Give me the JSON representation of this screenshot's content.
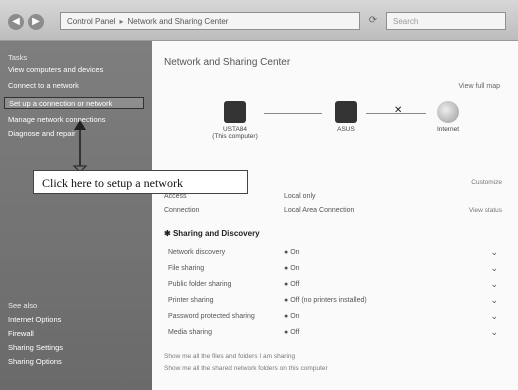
{
  "address": {
    "crumbs": [
      "Control Panel",
      "Network and Sharing Center"
    ],
    "search_placeholder": "Search"
  },
  "sidebar": {
    "tasks_header": "Tasks",
    "links": [
      "View computers and devices",
      "Connect to a network",
      "Set up a connection or network",
      "Manage network connections",
      "Diagnose and repair"
    ],
    "see_also_header": "See also",
    "see_also": [
      "Internet Options",
      "Firewall",
      "Sharing Settings",
      "Sharing Options"
    ]
  },
  "main": {
    "title": "Network and Sharing Center",
    "full_map": "View full map",
    "nodes": [
      {
        "name": "USTA84",
        "sub": "(This computer)"
      },
      {
        "name": "ASUS",
        "sub": ""
      },
      {
        "name": "Internet",
        "sub": ""
      }
    ],
    "customize": "Customize",
    "access_label": "Access",
    "access_value": "Local only",
    "connection_label": "Connection",
    "connection_value": "Local Area Connection",
    "view_status": "View status",
    "sharing_header": "Sharing and Discovery",
    "sharing_rows": [
      {
        "label": "Network discovery",
        "value": "On"
      },
      {
        "label": "File sharing",
        "value": "On"
      },
      {
        "label": "Public folder sharing",
        "value": "Off"
      },
      {
        "label": "Printer sharing",
        "value": "Off (no printers installed)"
      },
      {
        "label": "Password protected sharing",
        "value": "On"
      },
      {
        "label": "Media sharing",
        "value": "Off"
      }
    ],
    "footer_lines": [
      "Show me all the files and folders I am sharing",
      "Show me all the shared network folders on this computer"
    ]
  },
  "callout": {
    "text": "Click here to setup a network"
  }
}
